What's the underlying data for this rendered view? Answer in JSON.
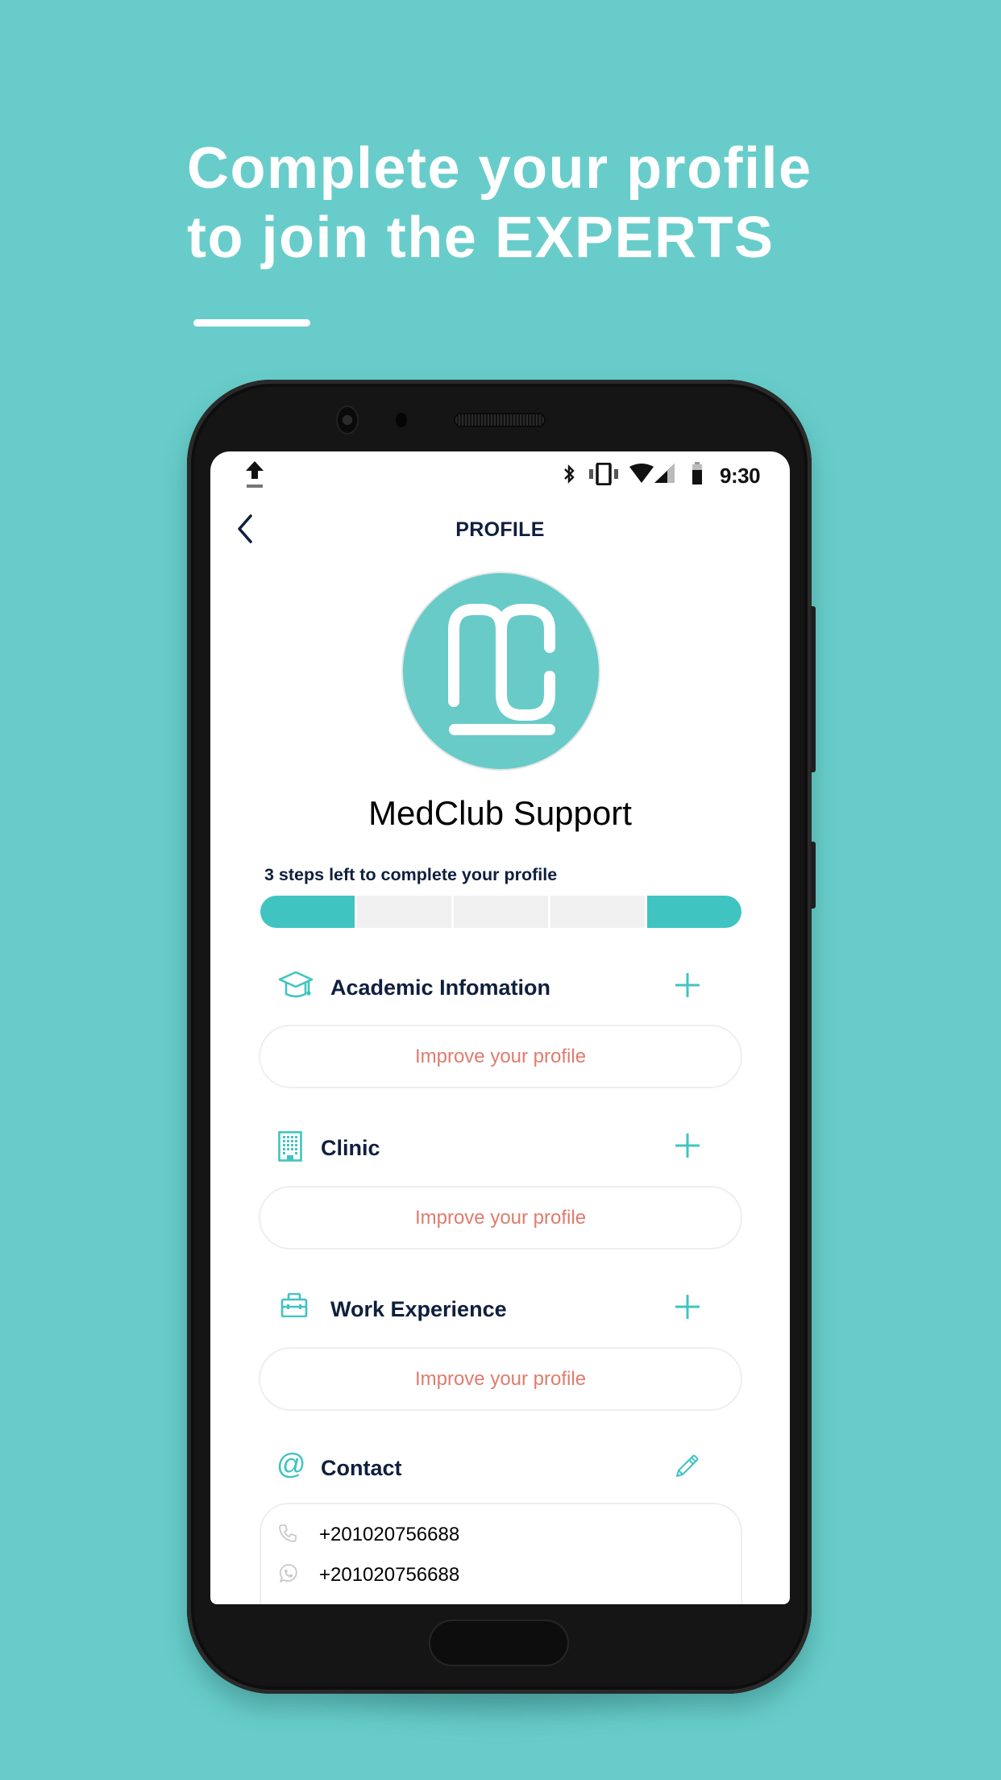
{
  "promo": {
    "headline_line1": "Complete your profile",
    "headline_line2": "to join the EXPERTS"
  },
  "status_bar": {
    "time": "9:30",
    "icons": [
      "upload-icon",
      "bluetooth-icon",
      "vibrate-icon",
      "wifi-icon",
      "cell-signal-icon",
      "battery-icon"
    ]
  },
  "nav": {
    "title": "PROFILE",
    "back_icon": "chevron-left-icon"
  },
  "profile": {
    "avatar_icon": "medclub-logo",
    "display_name": "MedClub Support",
    "steps_left_text": "3 steps left to complete your profile",
    "progress": {
      "total_steps": 5,
      "completed_steps": 2,
      "segments_done": [
        true,
        false,
        false,
        false,
        true
      ]
    }
  },
  "sections": [
    {
      "title": "Academic Infomation",
      "icon": "graduation-cap-icon",
      "action_icon": "plus-icon",
      "button_label": "Improve your profile"
    },
    {
      "title": "Clinic",
      "icon": "building-icon",
      "action_icon": "plus-icon",
      "button_label": "Improve your profile"
    },
    {
      "title": "Work Experience",
      "icon": "toolbox-icon",
      "action_icon": "plus-icon",
      "button_label": "Improve your profile"
    }
  ],
  "contact": {
    "title": "Contact",
    "icon": "at-sign-icon",
    "action_icon": "pencil-icon",
    "phone": "+201020756688",
    "whatsapp": "+201020756688"
  },
  "colors": {
    "background": "#68cdca",
    "accent": "#3fc4c2",
    "heading": "#0f1f3d",
    "improve_text": "#e07b6d",
    "progress_empty": "#f0f0f0"
  }
}
